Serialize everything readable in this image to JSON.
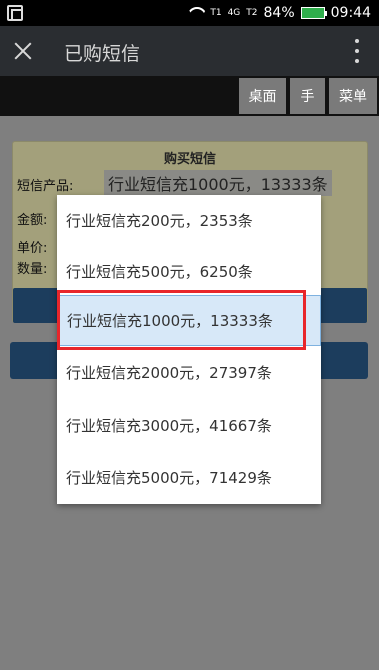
{
  "status_bar": {
    "signal_top": "T1",
    "network": "4G",
    "signal_top2": "T2",
    "battery_percent": "84%",
    "time": "09:44"
  },
  "title_bar": {
    "title": "已购短信"
  },
  "menu": {
    "items": [
      "桌面",
      "手",
      "菜单"
    ]
  },
  "form": {
    "heading": "购买短信",
    "product_label": "短信产品:",
    "selected_product": "行业短信充1000元，13333条",
    "amount_label": "金额:",
    "price_label": "单价:",
    "qty_label": "数量:"
  },
  "dropdown": {
    "options": [
      "行业短信充200元，2353条",
      "行业短信充500元，6250条",
      "行业短信充1000元，13333条",
      "行业短信充2000元，27397条",
      "行业短信充3000元，41667条",
      "行业短信充5000元，71429条"
    ],
    "selected_index": 2
  },
  "colors": {
    "highlight_border": "#e8262b",
    "selected_bg": "#d7e8f8",
    "button_bg": "#1c3d5d"
  }
}
